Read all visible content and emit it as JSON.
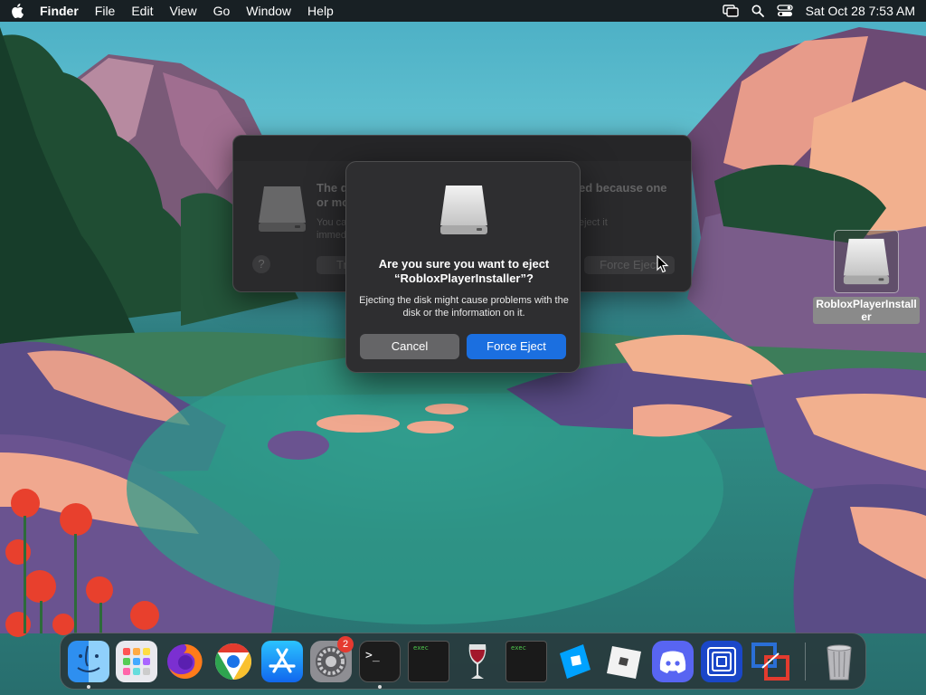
{
  "menubar": {
    "app_name": "Finder",
    "items": [
      "File",
      "Edit",
      "View",
      "Go",
      "Window",
      "Help"
    ],
    "clock": "Sat Oct 28  7:53 AM"
  },
  "background_dialog": {
    "title_visible": "The d                                                         ed because one or mo",
    "title_left": "The d",
    "title_left2": "or mo",
    "title_right": "ed because one",
    "body_left": "You ca",
    "body_left2": "immed",
    "body_right": "eject it",
    "help": "?",
    "left_button": "Tr",
    "right_button": "Force Eject"
  },
  "alert": {
    "title": "Are you sure you want to eject “RobloxPlayerInstaller”?",
    "message": "Ejecting the disk might cause problems with the disk or the information on it.",
    "cancel_label": "Cancel",
    "force_label": "Force Eject"
  },
  "desktop_icon": {
    "label": "RobloxPlayerInstaller"
  },
  "dock": {
    "exec_label": "exec",
    "terminal_prompt": ">_",
    "settings_badge": "2",
    "apps": [
      "finder",
      "launchpad",
      "firefox",
      "chrome",
      "app-store",
      "system-settings",
      "terminal",
      "exec-1",
      "wine",
      "exec-2",
      "roblox-studio",
      "roblox",
      "discord",
      "virtualbuddy",
      "parallels",
      "trash"
    ]
  }
}
